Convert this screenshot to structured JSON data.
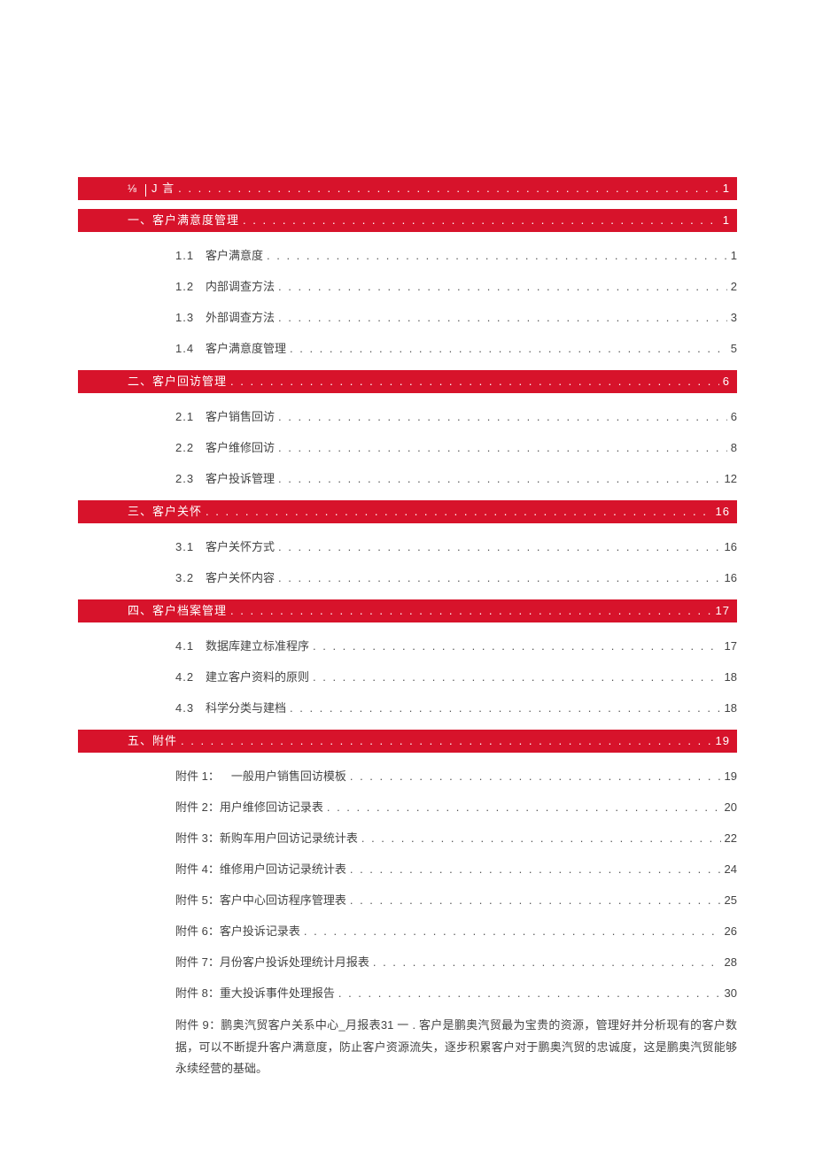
{
  "leader_dots": ". . . . . . . . . . . . . . . . . . . . . . . . . . . . . . . . . . . . . . . . . . . . . . . . . . . . . . . . . . . . . . . . . . . . . . . . . . . . . . . . . . . . . . . . . . . . . . . . . . . . . . . . . . . . . . . . . . . . . . . . . . . . . . . . . . . . . . . . . . . . . . . . . . . . . .",
  "intro": {
    "icon": "⅛",
    "label": "J 言",
    "page": "1"
  },
  "sections": [
    {
      "label": "一、客户满意度管理",
      "page": "1",
      "items": [
        {
          "num": "1.1",
          "label": "客户满意度",
          "page": "1"
        },
        {
          "num": "1.2",
          "label": "内部调查方法",
          "page": "2"
        },
        {
          "num": "1.3",
          "label": "外部调查方法",
          "page": "3"
        },
        {
          "num": "1.4",
          "label": "客户满意度管理",
          "page": "5"
        }
      ]
    },
    {
      "label": "二、客户回访管理",
      "page": "6",
      "items": [
        {
          "num": "2.1",
          "label": "客户销售回访",
          "page": "6"
        },
        {
          "num": "2.2",
          "label": "客户维修回访",
          "page": "8"
        },
        {
          "num": "2.3",
          "label": "客户投诉管理",
          "page": "12"
        }
      ]
    },
    {
      "label": "三、客户关怀",
      "page": "16",
      "items": [
        {
          "num": "3.1",
          "label": "客户关怀方式",
          "page": "16"
        },
        {
          "num": "3.2",
          "label": "客户关怀内容",
          "page": "16"
        }
      ]
    },
    {
      "label": "四、客户档案管理",
      "page": "17",
      "items": [
        {
          "num": "4.1",
          "label": "数据库建立标准程序",
          "page": "17"
        },
        {
          "num": "4.2",
          "label": "建立客户资料的原则",
          "page": "18"
        },
        {
          "num": "4.3",
          "label": "科学分类与建档",
          "page": "18"
        }
      ]
    },
    {
      "label": "五、附件",
      "page": "19",
      "items": [
        {
          "num": "",
          "label": "附件 1： 一般用户销售回访模板",
          "page": "19"
        },
        {
          "num": "",
          "label": "附件 2：用户维修回访记录表",
          "page": "20"
        },
        {
          "num": "",
          "label": "附件 3：新购车用户回访记录统计表",
          "page": "22"
        },
        {
          "num": "",
          "label": "附件 4：维修用户回访记录统计表",
          "page": "24"
        },
        {
          "num": "",
          "label": "附件 5：客户中心回访程序管理表",
          "page": "25"
        },
        {
          "num": "",
          "label": "附件 6：客户投诉记录表",
          "page": "26"
        },
        {
          "num": "",
          "label": "附件 7：月份客户投诉处理统计月报表",
          "page": "28"
        },
        {
          "num": "",
          "label": "附件 8：重大投诉事件处理报告",
          "page": "30"
        }
      ]
    }
  ],
  "note_text": "附件 9：鹏奥汽贸客户关系中心_月报表31 一 . 客户是鹏奥汽贸最为宝贵的资源，管理好并分析现有的客户数据，可以不断提升客户满意度，防止客户资源流失，逐步积累客户对于鹏奥汽贸的忠诚度，这是鹏奥汽贸能够永续经营的基础。"
}
